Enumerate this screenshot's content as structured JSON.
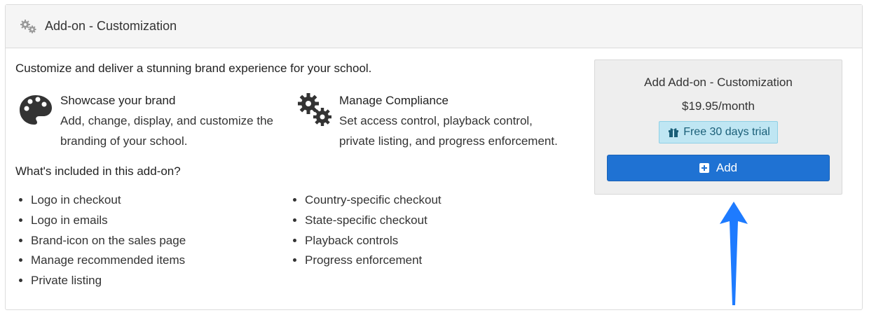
{
  "panel": {
    "title": "Add-on - Customization",
    "icon": "gears-icon"
  },
  "intro": "Customize and deliver a stunning brand experience for your school.",
  "features": [
    {
      "icon": "palette-icon",
      "title": "Showcase your brand",
      "desc_line1": "Add, change, display, and customize the",
      "desc_line2": "branding of your school."
    },
    {
      "icon": "gears-icon",
      "title": "Manage Compliance",
      "desc_line1": "Set access control, playback control,",
      "desc_line2": "private listing, and progress enforcement."
    }
  ],
  "included_heading": "What's included in this add-on?",
  "list_left": [
    "Logo in checkout",
    "Logo in emails",
    "Brand-icon on the sales page",
    "Manage recommended items",
    "Private listing"
  ],
  "list_right": [
    "Country-specific checkout",
    "State-specific checkout",
    "Playback controls",
    "Progress enforcement"
  ],
  "buy": {
    "title": "Add Add-on - Customization",
    "price": "$19.95/month",
    "trial_label": "Free 30 days trial",
    "add_label": "Add",
    "button_color": "#1f72d3",
    "trial_bg": "#bfe6f3"
  },
  "annotation": {
    "arrow_color": "#1e7bff"
  }
}
